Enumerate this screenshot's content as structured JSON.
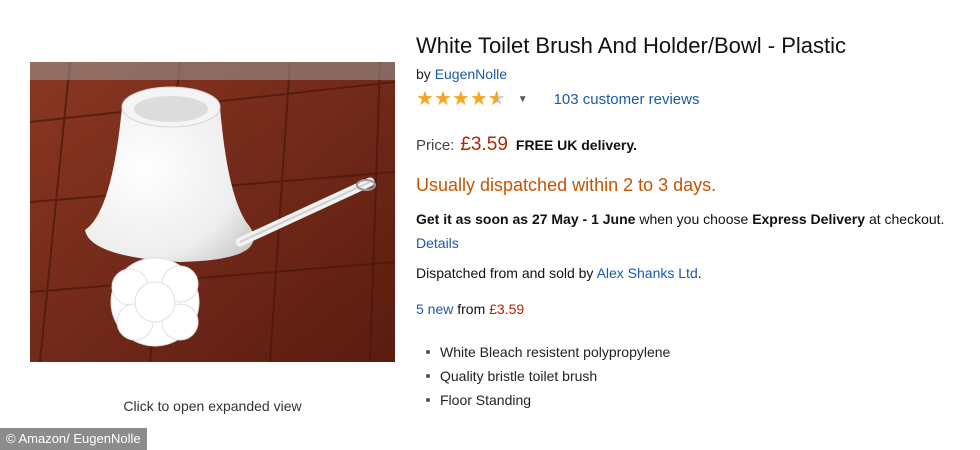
{
  "product": {
    "title": "White Toilet Brush And Holder/Bowl - Plastic",
    "by_prefix": "by",
    "brand": "EugenNolle",
    "rating": 4.5,
    "reviews_text": "103 customer reviews"
  },
  "pricing": {
    "label": "Price:",
    "price": "£3.59",
    "delivery_note": "FREE UK delivery."
  },
  "availability": "Usually dispatched within 2 to 3 days.",
  "delivery": {
    "prefix": "Get it as soon as",
    "dates": "27 May - 1 June",
    "middle": "when you choose",
    "method": "Express Delivery",
    "suffix": "at checkout.",
    "details_link": "Details"
  },
  "seller": {
    "text": "Dispatched from and sold by",
    "name": "Alex Shanks Ltd",
    "end": "."
  },
  "offers": {
    "count_link": "5 new",
    "from_text": "from",
    "price": "£3.59"
  },
  "bullets": [
    "White Bleach resistent polypropylene",
    "Quality bristle toilet brush",
    "Floor Standing"
  ],
  "image": {
    "caption": "Click to open expanded view"
  },
  "credit": "© Amazon/ EugenNolle",
  "colors": {
    "link": "#1a5aa8",
    "price": "#b12704",
    "availability": "#c45500",
    "star": "#f5a623"
  }
}
